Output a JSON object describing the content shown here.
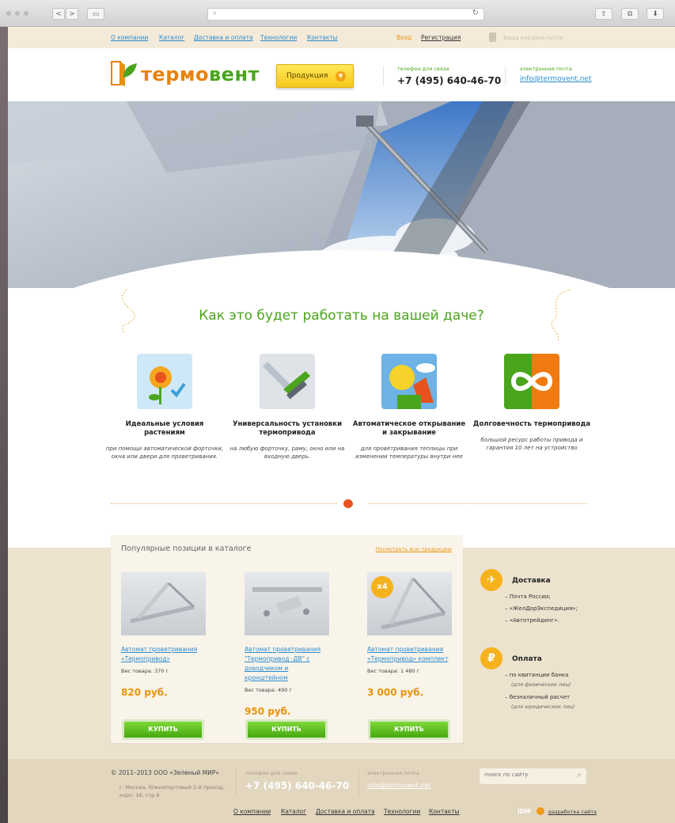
{
  "browser": {
    "back": "<",
    "forward": ">",
    "url": ""
  },
  "topnav": {
    "links": [
      "О компании",
      "Каталог",
      "Доставка и оплата",
      "Технологии",
      "Контакты"
    ],
    "login": "Вход",
    "register": "Регистрация",
    "cart": "Ваша корзина пуста"
  },
  "header": {
    "logo_a": "термо",
    "logo_b": "вент",
    "products_button": "Продукция",
    "phone_label": "телефон для связи",
    "phone": "+7 (495) 640-46-70",
    "email_label": "электронная почта",
    "email": "info@termovent.net"
  },
  "headline": "Как это будет работать на вашей даче?",
  "features": [
    {
      "icon": "flower-icon",
      "title": "Идеальные условия растениям",
      "text": "при помощи автоматической форточки, окна или двери для проветривания."
    },
    {
      "icon": "multitool-icon",
      "title": "Универсальность установки термопривода",
      "text": "на любую форточку, раму, окно или на входную дверь."
    },
    {
      "icon": "sun-icon",
      "title": "Автоматическое открывание и закрывание",
      "text": "для проветривания теплицы при изменении температуры внутри нее"
    },
    {
      "icon": "infinity-icon",
      "title": "Долговечность термопривода",
      "text": "большой ресурс работы привода и гарантия 10 лет на устройство"
    }
  ],
  "catalog": {
    "title": "Популярные позиции в каталоге",
    "see_all": "Посмотреть всю продукцию",
    "buy_label": "КУПИТЬ",
    "items": [
      {
        "name": "Автомат проветривания «Термопривод»",
        "weight": "Вес товара: 370 г",
        "price": "820 руб.",
        "badge": ""
      },
      {
        "name": "Автомат проветривания \"Термопривод -ДВ\" с доводчиком и кронштейном",
        "weight": "Вес товара: 490 г",
        "price": "950 руб.",
        "badge": ""
      },
      {
        "name": "Автомат проветривания «Термопривод» комплект",
        "weight": "Вес товара: 1 480 г",
        "price": "3 000 руб.",
        "badge": "x4"
      }
    ]
  },
  "delivery": {
    "title": "Доставка",
    "items": [
      "– Почта России;",
      "– «ЖелДорЭкспедиция»;",
      "– «Автотрейдинг»."
    ]
  },
  "payment": {
    "title": "Оплата",
    "symbol": "₽",
    "items": [
      {
        "text": "– по квитанции банка",
        "note": "(для физических лиц)"
      },
      {
        "text": "– безналичный расчет",
        "note": "(для юридических лиц)"
      }
    ]
  },
  "footer": {
    "copyright": "© 2011–2013 ООО «Зеленый МИР»",
    "address": "г. Москва, Южнопортовый 2-й проезд, корп. 16, стр 8",
    "phone_label": "телефон для связи",
    "phone": "+7 (495) 640-46-70",
    "email_label": "электронная почта",
    "email": "info@termovent.net",
    "search_placeholder": "поиск по сайту",
    "links": [
      "О компании",
      "Каталог",
      "Доставка и оплата",
      "Технологии",
      "Контакты"
    ],
    "dev_brand": "IDM",
    "dev_link": "разработка сайта"
  },
  "colors": {
    "green": "#4aa51d",
    "orange": "#e8920c",
    "link": "#2a8bd0",
    "tan": "#ede2ce"
  }
}
